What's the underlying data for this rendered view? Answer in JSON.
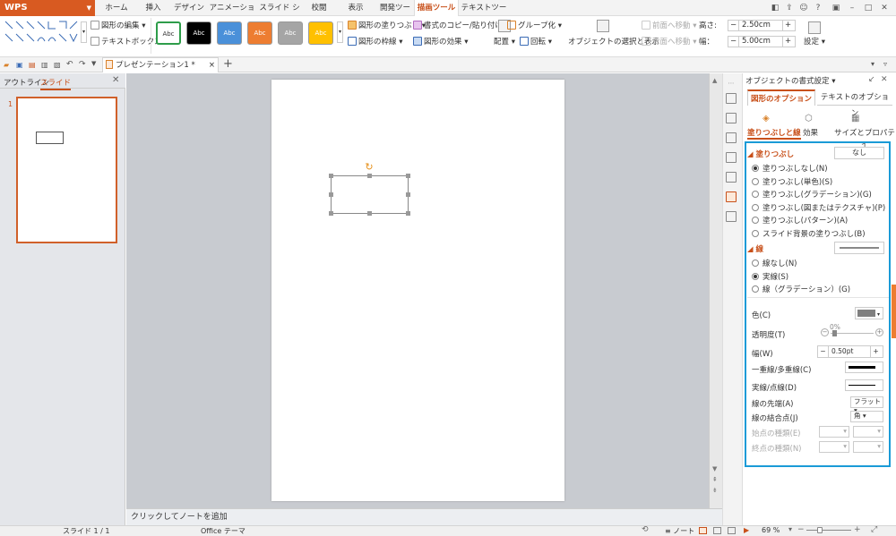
{
  "app": {
    "name": "WPS Presentation"
  },
  "menu": {
    "tabs": [
      "ホーム",
      "挿入",
      "デザイン",
      "アニメーション",
      "スライド ショー",
      "校閲",
      "表示",
      "開発ツール",
      "描画ツール",
      "テキストツール"
    ],
    "active": "描画ツール"
  },
  "ribbon": {
    "shape_edit": "図形の編集",
    "text_box": "テキストボックス",
    "style_label": "Abc",
    "style_colors": [
      "#ffffff",
      "#000000",
      "#4a90d9",
      "#ed7d31",
      "#a5a5a5",
      "#ffc000"
    ],
    "fill": "図形の塗りつぶし",
    "outline": "図形の枠線",
    "format_painter": "書式のコピー/貼り付け",
    "effects": "図形の効果",
    "arrange": "配置",
    "group": "グループ化",
    "rotate": "回転",
    "select_objects": "オブジェクトの選択と表示",
    "bring_forward": "前面へ移動",
    "send_backward": "背面へ移動",
    "height_label": "高さ:",
    "height_value": "2.50cm",
    "width_label": "幅：",
    "width_value": "5.00cm",
    "settings": "設定"
  },
  "tabbar": {
    "document": "プレゼンテーション1 *"
  },
  "left_pane": {
    "tab_outline": "アウトライン",
    "tab_slides": "スライド",
    "slide_number": "1"
  },
  "notes_placeholder": "クリックしてノートを追加",
  "panel": {
    "title": "オブジェクトの書式設定",
    "tab_shape": "図形のオプション",
    "tab_text": "テキストのオプション",
    "subtab_fill_line": "塗りつぶしと線",
    "subtab_effects": "効果",
    "subtab_size": "サイズとプロパティ",
    "fill_section": "塗りつぶし",
    "fill_value": "なし",
    "fill_options": [
      "塗りつぶしなし(N)",
      "塗りつぶし(単色)(S)",
      "塗りつぶし(グラデーション)(G)",
      "塗りつぶし(図またはテクスチャ)(P)",
      "塗りつぶし(パターン)(A)",
      "スライド背景の塗りつぶし(B)"
    ],
    "fill_selected": 0,
    "line_section": "線",
    "line_options": [
      "線なし(N)",
      "実線(S)",
      "線（グラデーション）(G)"
    ],
    "line_selected": 1,
    "color_label": "色(C)",
    "line_color": "#7f7f7f",
    "transparency_label": "透明度(T)",
    "transparency_value": "0%",
    "width_label": "幅(W)",
    "width_value": "0.50pt",
    "compound_label": "一重線/多重線(C)",
    "dash_label": "実線/点線(D)",
    "cap_label": "線の先端(A)",
    "cap_value": "フラット",
    "join_label": "線の結合点(J)",
    "join_value": "角",
    "begin_arrow_label": "始点の種類(E)",
    "end_arrow_label": "終点の種類(N)"
  },
  "status": {
    "slide": "スライド 1 / 1",
    "theme": "Office テーマ",
    "notes": "ノート",
    "zoom": "69 %"
  },
  "accent": "#c8501a",
  "highlight": "#1a9bd7"
}
